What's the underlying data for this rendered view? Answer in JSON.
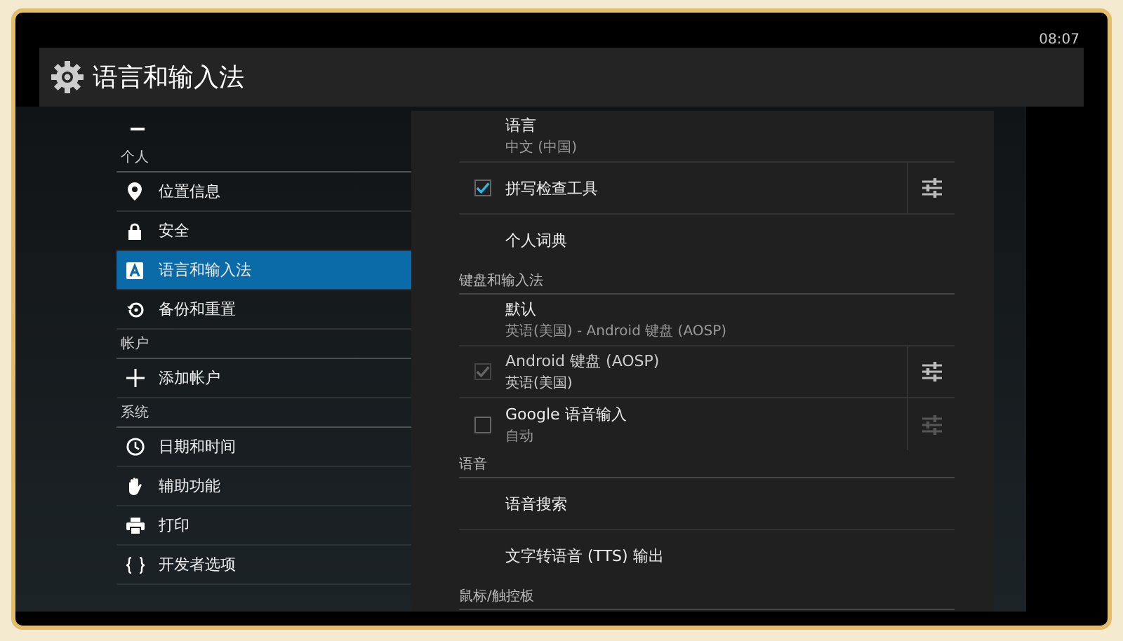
{
  "status_bar": {
    "time": "08:07"
  },
  "header": {
    "title": "语言和输入法"
  },
  "sidebar": {
    "items": [
      {
        "kind": "header",
        "label": "个人"
      },
      {
        "kind": "item",
        "label": "位置信息",
        "selected": false
      },
      {
        "kind": "item",
        "label": "安全",
        "selected": false
      },
      {
        "kind": "item",
        "label": "语言和输入法",
        "selected": true
      },
      {
        "kind": "item",
        "label": "备份和重置",
        "selected": false
      },
      {
        "kind": "header",
        "label": "帐户"
      },
      {
        "kind": "item",
        "label": "添加帐户",
        "selected": false
      },
      {
        "kind": "header",
        "label": "系统"
      },
      {
        "kind": "item",
        "label": "日期和时间",
        "selected": false
      },
      {
        "kind": "item",
        "label": "辅助功能",
        "selected": false
      },
      {
        "kind": "item",
        "label": "打印",
        "selected": false
      },
      {
        "kind": "item",
        "label": "开发者选项",
        "selected": false
      }
    ]
  },
  "preferences": [
    {
      "kind": "text",
      "title": "语言",
      "summary": "中文 (中国)"
    },
    {
      "kind": "check",
      "title": "拼写检查工具",
      "checked": true,
      "disabled": false,
      "settings_disabled": false
    },
    {
      "kind": "text",
      "title": "个人词典"
    },
    {
      "kind": "section",
      "title": "键盘和输入法"
    },
    {
      "kind": "text",
      "title": "默认",
      "summary": "英语(美国) - Android 键盘 (AOSP)"
    },
    {
      "kind": "check",
      "title": "Android 键盘 (AOSP)",
      "summary": "英语(美国)",
      "checked": true,
      "disabled": true,
      "settings_disabled": false
    },
    {
      "kind": "check",
      "title": "Google 语音输入",
      "summary": "自动",
      "checked": false,
      "disabled": false,
      "settings_disabled": true
    },
    {
      "kind": "section",
      "title": "语音"
    },
    {
      "kind": "text",
      "title": "语音搜索"
    },
    {
      "kind": "text",
      "title": "文字转语音 (TTS) 输出"
    },
    {
      "kind": "section",
      "title": "鼠标/触控板"
    }
  ]
}
